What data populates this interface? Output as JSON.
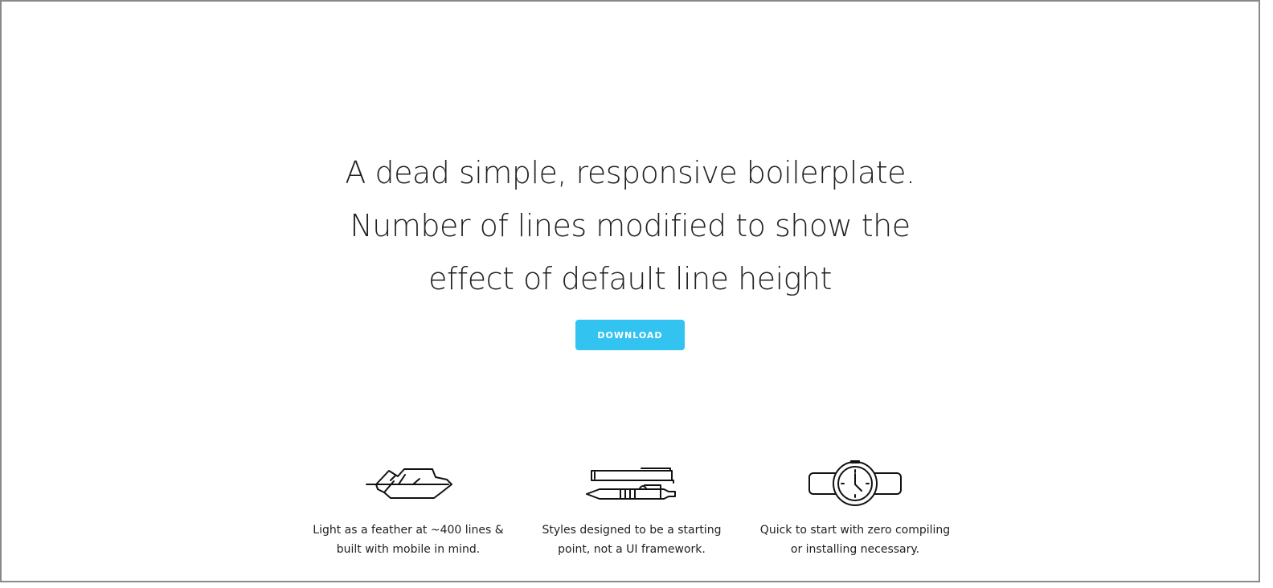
{
  "hero": {
    "title_lines": [
      "A dead simple, responsive boilerplate.",
      "Number of lines modified to show the",
      "effect of default line height"
    ],
    "button_label": "DOWNLOAD"
  },
  "features": [
    {
      "icon": "feather-icon",
      "text_lines": [
        "Light as a feather at ~400 lines &",
        "built with mobile in mind."
      ]
    },
    {
      "icon": "pens-icon",
      "text_lines": [
        "Styles designed to be a starting",
        "point, not a UI framework."
      ]
    },
    {
      "icon": "watch-icon",
      "text_lines": [
        "Quick to start with zero compiling",
        "or installing necessary."
      ]
    }
  ],
  "colors": {
    "button_bg": "#33c3f0",
    "text": "#222222"
  }
}
